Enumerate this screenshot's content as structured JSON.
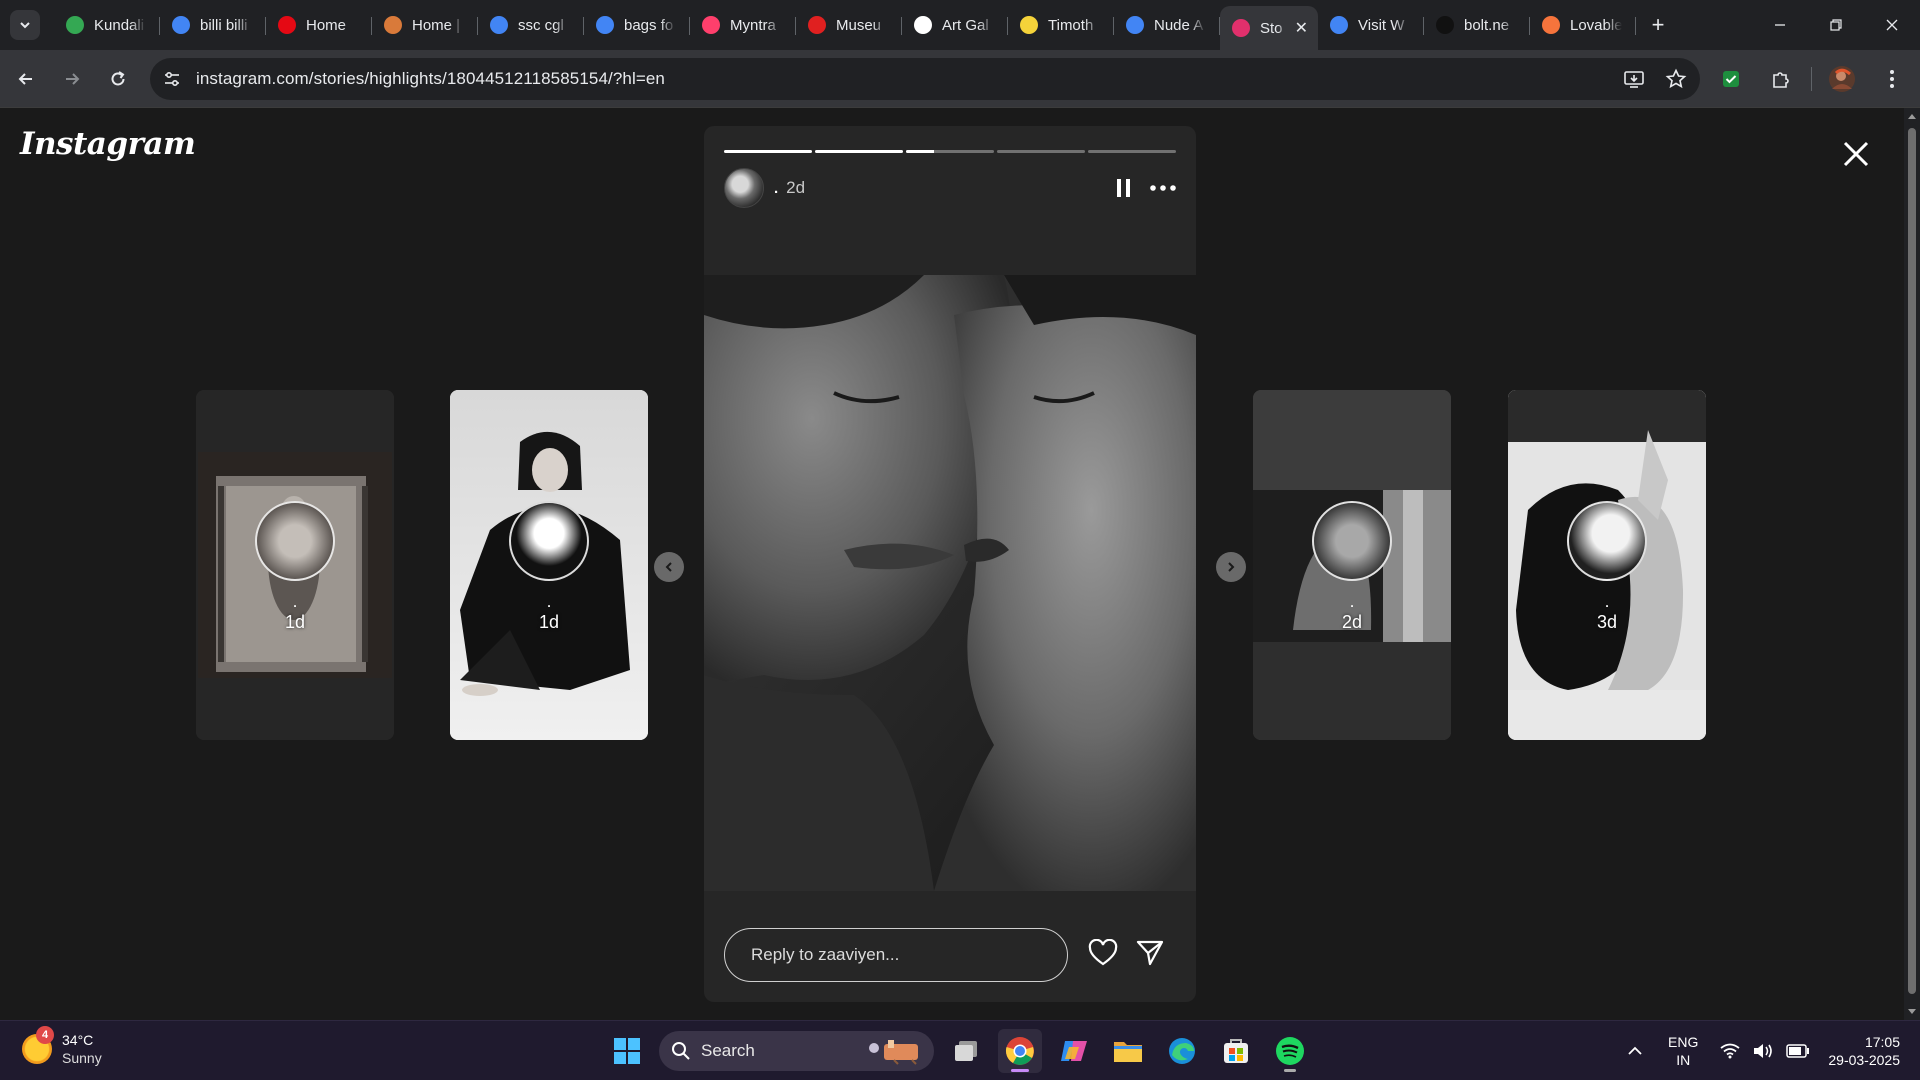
{
  "browser": {
    "tabs": [
      {
        "title": "Kundali",
        "icon": "google-maps-icon",
        "color": "#34a853"
      },
      {
        "title": "billi billi",
        "icon": "google-icon",
        "color": "#4285f4"
      },
      {
        "title": "Home",
        "icon": "netflix-icon",
        "color": "#e50914"
      },
      {
        "title": "Home |",
        "icon": "site-icon",
        "color": "#d97a3a"
      },
      {
        "title": "ssc cgl",
        "icon": "google-icon",
        "color": "#4285f4"
      },
      {
        "title": "bags fo",
        "icon": "google-icon",
        "color": "#4285f4"
      },
      {
        "title": "Myntra",
        "icon": "myntra-icon",
        "color": "#ff3f6c"
      },
      {
        "title": "Museu",
        "icon": "asterisk-icon",
        "color": "#e02020"
      },
      {
        "title": "Art Gal",
        "icon": "openai-icon",
        "color": "#ffffff"
      },
      {
        "title": "Timoth",
        "icon": "emoji-icon",
        "color": "#f5d33a"
      },
      {
        "title": "Nude A",
        "icon": "google-icon",
        "color": "#4285f4"
      },
      {
        "title": "Sto",
        "icon": "instagram-icon",
        "color": "#e1306c",
        "active": true
      },
      {
        "title": "Visit W",
        "icon": "google-icon",
        "color": "#4285f4"
      },
      {
        "title": "bolt.ne",
        "icon": "bolt-icon",
        "color": "#111111"
      },
      {
        "title": "Lovable",
        "icon": "heart-icon",
        "color": "#f6743c"
      }
    ],
    "url": "instagram.com/stories/highlights/18044512118585154/?hl=en"
  },
  "page": {
    "logo_text": "Instagram",
    "story": {
      "progress": [
        1.0,
        1.0,
        0.32,
        0.0,
        0.0
      ],
      "username": ".",
      "time": "2d",
      "reply_placeholder": "Reply to zaaviyen..."
    },
    "side_stories": [
      {
        "name": ".",
        "time": "1d"
      },
      {
        "name": ".",
        "time": "1d"
      },
      {
        "name": ".",
        "time": "2d"
      },
      {
        "name": ".",
        "time": "3d"
      }
    ]
  },
  "taskbar": {
    "weather_badge": "4",
    "temperature": "34°C",
    "condition": "Sunny",
    "search_label": "Search",
    "lang_line1": "ENG",
    "lang_line2": "IN",
    "time": "17:05",
    "date": "29-03-2025"
  }
}
